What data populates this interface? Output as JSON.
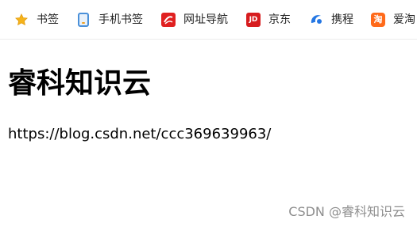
{
  "bookmarks_bar": {
    "items": [
      {
        "label": "书签",
        "icon": "star-icon"
      },
      {
        "label": "手机书签",
        "icon": "phone-icon"
      },
      {
        "label": "网址导航",
        "icon": "navigation-icon"
      },
      {
        "label": "京东",
        "icon": "jd-icon",
        "icon_text": "JD"
      },
      {
        "label": "携程",
        "icon": "ctrip-icon"
      },
      {
        "label": "爱淘",
        "icon": "taobao-icon",
        "icon_text": "淘"
      }
    ]
  },
  "content": {
    "title": "睿科知识云",
    "url_text": "https://blog.csdn.net/ccc369639963/"
  },
  "watermark": {
    "text": "CSDN @睿科知识云"
  },
  "colors": {
    "star": "#f5b31a",
    "phone": "#4a90d9",
    "navigation": "#e02020",
    "jd": "#d71c1e",
    "ctrip": "#2577e3",
    "taobao": "#ff6a1a",
    "watermark": "#8f8f8f"
  }
}
